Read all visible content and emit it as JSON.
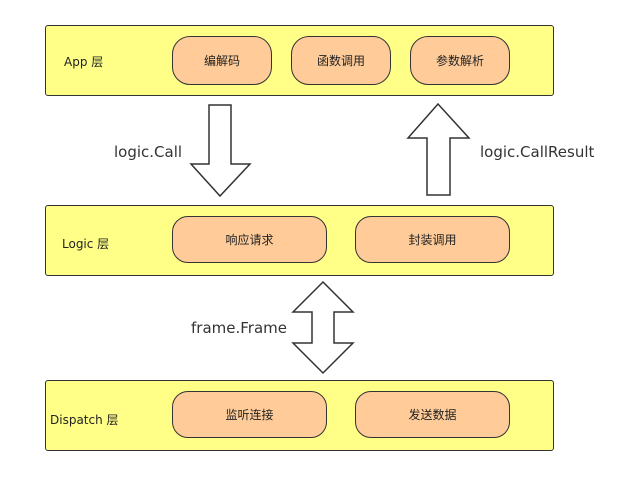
{
  "layers": {
    "app": {
      "label": "App 层",
      "items": [
        "编解码",
        "函数调用",
        "参数解析"
      ]
    },
    "logic": {
      "label": "Logic 层",
      "items": [
        "响应请求",
        "封装调用"
      ]
    },
    "dispatch": {
      "label": "Dispatch 层",
      "items": [
        "监听连接",
        "发送数据"
      ]
    }
  },
  "arrows": {
    "call": "logic.Call",
    "call_result": "logic.CallResult",
    "frame": "frame.Frame"
  },
  "colors": {
    "layer_fill": "#ffff88",
    "pill_fill": "#ffcc99",
    "stroke": "#333333"
  }
}
